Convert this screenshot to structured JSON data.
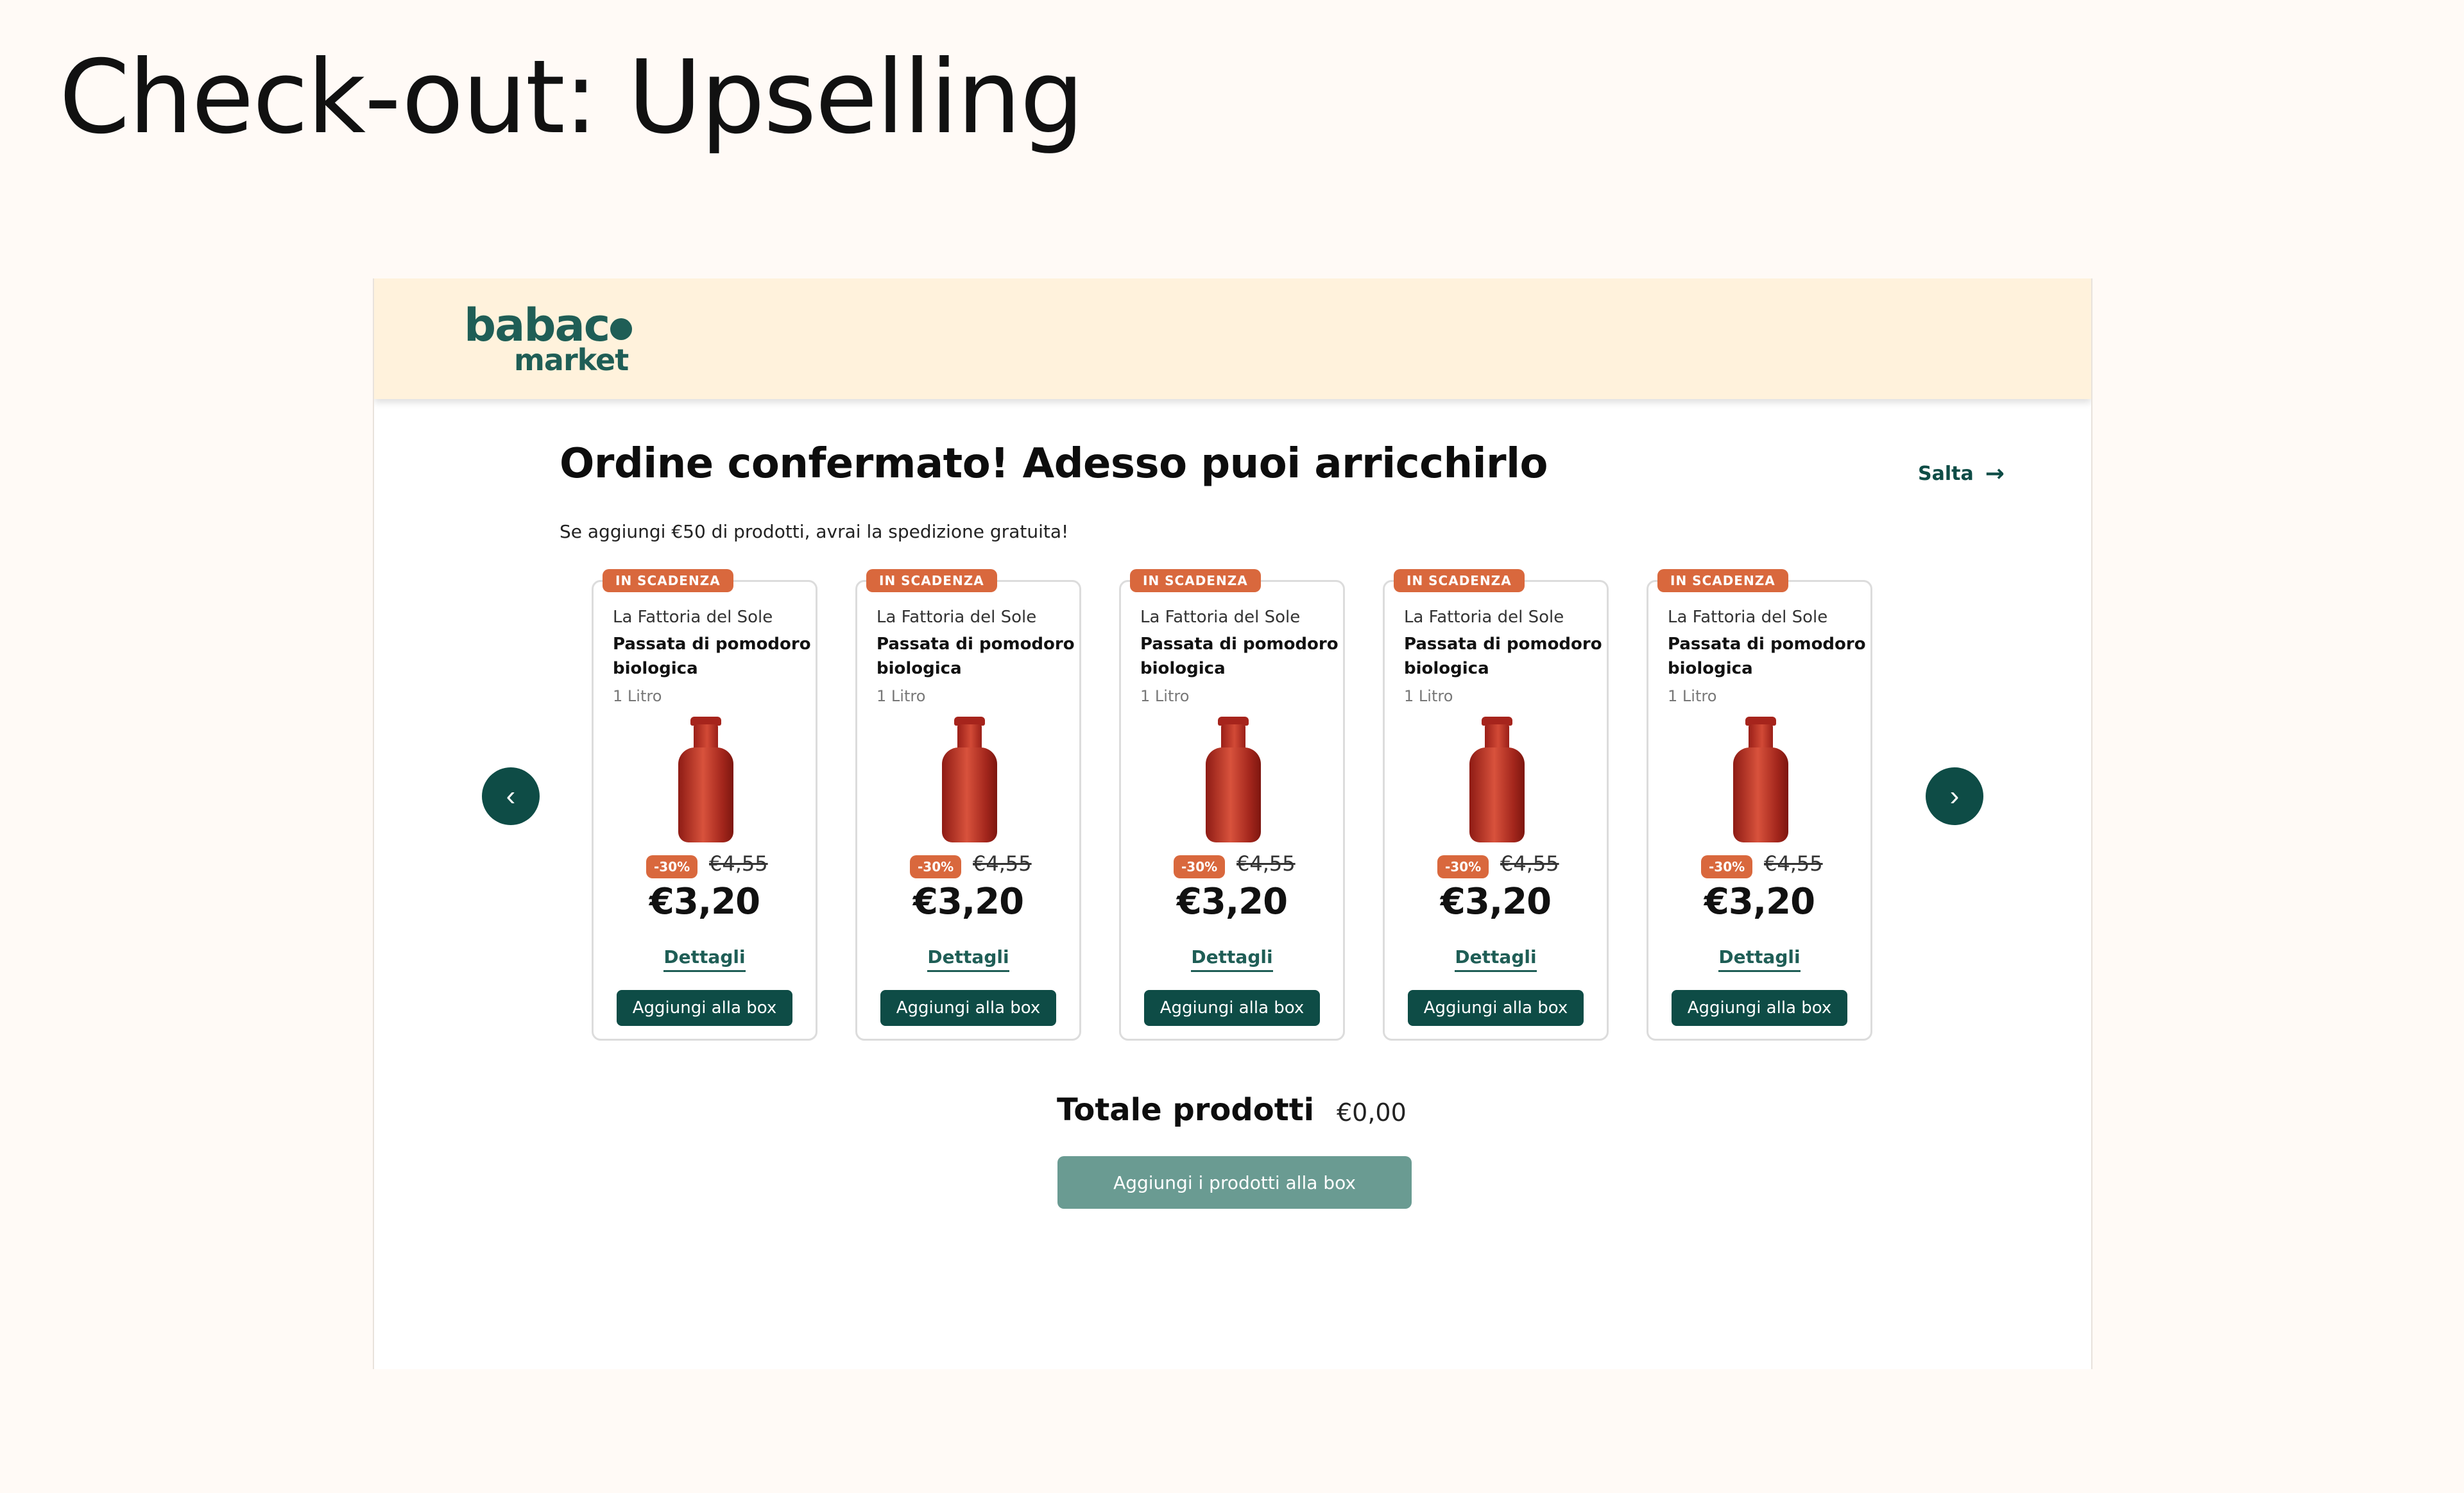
{
  "page_heading": "Check-out: Upselling",
  "logo": {
    "line1": "babac",
    "line2": "market"
  },
  "main": {
    "title": "Ordine confermato! Adesso puoi arricchirlo",
    "subtitle": "Se aggiungi €50 di prodotti, avrai la spedizione gratuita!",
    "skip_label": "Salta",
    "skip_icon": "arrow-right-icon",
    "prev_icon": "chevron-left-icon",
    "next_icon": "chevron-right-icon"
  },
  "products": [
    {
      "badge": "IN SCADENZA",
      "brand": "La Fattoria del Sole",
      "name": "Passata di pomodoro biologica",
      "size": "1 Litro",
      "discount": "-30%",
      "old_price": "€4,55",
      "price": "€3,20",
      "details_label": "Dettagli",
      "add_label": "Aggiungi alla box"
    },
    {
      "badge": "IN SCADENZA",
      "brand": "La Fattoria del Sole",
      "name": "Passata di pomodoro biologica",
      "size": "1 Litro",
      "discount": "-30%",
      "old_price": "€4,55",
      "price": "€3,20",
      "details_label": "Dettagli",
      "add_label": "Aggiungi alla box"
    },
    {
      "badge": "IN SCADENZA",
      "brand": "La Fattoria del Sole",
      "name": "Passata di pomodoro biologica",
      "size": "1 Litro",
      "discount": "-30%",
      "old_price": "€4,55",
      "price": "€3,20",
      "details_label": "Dettagli",
      "add_label": "Aggiungi alla box"
    },
    {
      "badge": "IN SCADENZA",
      "brand": "La Fattoria del Sole",
      "name": "Passata di pomodoro biologica",
      "size": "1 Litro",
      "discount": "-30%",
      "old_price": "€4,55",
      "price": "€3,20",
      "details_label": "Dettagli",
      "add_label": "Aggiungi alla box"
    },
    {
      "badge": "IN SCADENZA",
      "brand": "La Fattoria del Sole",
      "name": "Passata di pomodoro biologica",
      "size": "1 Litro",
      "discount": "-30%",
      "old_price": "€4,55",
      "price": "€3,20",
      "details_label": "Dettagli",
      "add_label": "Aggiungi alla box"
    }
  ],
  "summary": {
    "total_label": "Totale prodotti",
    "total_value": "€0,00",
    "add_all_label": "Aggiungi i prodotti alla box"
  },
  "colors": {
    "brand_green": "#0e4c46",
    "accent_orange": "#d9683d",
    "header_bg": "#fff2dc",
    "disabled_button": "#6a9b92"
  }
}
